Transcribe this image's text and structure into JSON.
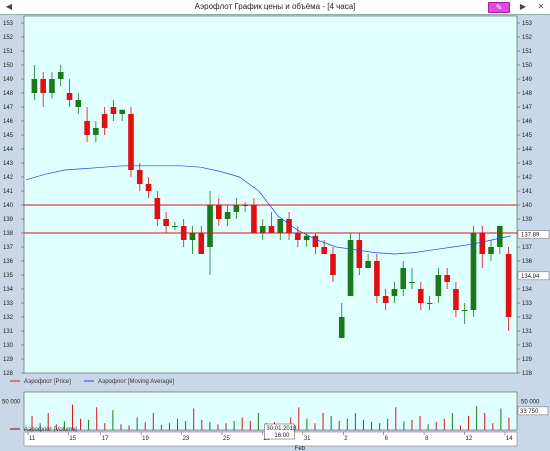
{
  "window": {
    "title": "Аэрофлот График цены и объёма - [4 часа]",
    "back_icon": "chevron-left-icon",
    "forward_icon": "chevron-right-icon",
    "close_icon": "close-icon",
    "draw_tool_icon": "pencil-icon"
  },
  "colors": {
    "plot_bg": "#e0ffff",
    "up": "#1a7a1a",
    "down": "#e01010",
    "ma": "#2040ff",
    "hline": "#e01010"
  },
  "price_chart": {
    "type": "candlestick",
    "y_ticks": [
      128,
      129,
      130,
      131,
      132,
      133,
      134,
      135,
      136,
      137,
      138,
      139,
      140,
      141,
      142,
      143,
      144,
      145,
      146,
      147,
      148,
      149,
      150,
      151,
      152,
      153
    ],
    "ylim": [
      128,
      153.5
    ],
    "price_badges": [
      "137.89",
      "134.94"
    ],
    "badge_values": [
      137.89,
      134.94
    ],
    "horizontal_lines": [
      140,
      138
    ],
    "legend": [
      "Аэрофлот [Price]",
      "Аэрофлот [Moving Average]"
    ]
  },
  "volume_chart": {
    "y_label_left": "50 000",
    "y_label_right": "50 000",
    "badge": "33 750",
    "badge_value": 33750,
    "legend": "Аэрофлот [Volume]"
  },
  "x_axis": {
    "labels": [
      "11",
      "15",
      "17",
      "19",
      "23",
      "25",
      "29",
      "31",
      "2",
      "6",
      "8",
      "12",
      "14"
    ],
    "label_index": [
      0,
      5,
      9,
      14,
      19,
      24,
      29,
      34,
      39,
      44,
      49,
      54,
      59
    ],
    "tooltip_date": "30.01.2018",
    "tooltip_time": "16:00",
    "month_label": "Feb"
  },
  "chart_data": {
    "type": "bar",
    "candles": [
      [
        148,
        150,
        147.5,
        149
      ],
      [
        149,
        149.5,
        147,
        148
      ],
      [
        148,
        149.5,
        147.6,
        149
      ],
      [
        149,
        150,
        148.5,
        149.5
      ],
      [
        148,
        149,
        147,
        147.5
      ],
      [
        147,
        148,
        146.5,
        147.5
      ],
      [
        146,
        147,
        144.5,
        145
      ],
      [
        145,
        146,
        144.5,
        145.5
      ],
      [
        146.5,
        147,
        145,
        145.5
      ],
      [
        147,
        147.5,
        146,
        146.5
      ],
      [
        146.5,
        146.8,
        146,
        146.8
      ],
      [
        146.5,
        147,
        142,
        142.5
      ],
      [
        142.5,
        143,
        141,
        141.5
      ],
      [
        141.5,
        142,
        140.5,
        141
      ],
      [
        140.5,
        141,
        138.5,
        139
      ],
      [
        139,
        139.5,
        138,
        138.5
      ],
      [
        138.5,
        138.8,
        138.2,
        138.5
      ],
      [
        138.5,
        139,
        137,
        137.5
      ],
      [
        137.5,
        138.5,
        136.5,
        138
      ],
      [
        138,
        138.5,
        136.5,
        136.5
      ],
      [
        137,
        141,
        135,
        140
      ],
      [
        140,
        140.5,
        138.5,
        139
      ],
      [
        139,
        140,
        138.5,
        139.5
      ],
      [
        139.5,
        140.5,
        139,
        140
      ],
      [
        140,
        140.2,
        139.5,
        140
      ],
      [
        140,
        140.5,
        138,
        138
      ],
      [
        138,
        139,
        137.5,
        138.5
      ],
      [
        138.5,
        139.5,
        138,
        138
      ],
      [
        138,
        139,
        137.5,
        139
      ],
      [
        139,
        139.5,
        137.5,
        138
      ],
      [
        138,
        138.5,
        137,
        137.5
      ],
      [
        137.5,
        138,
        137,
        137.8
      ],
      [
        137.8,
        138,
        136.5,
        137
      ],
      [
        137,
        137.5,
        136.5,
        136.5
      ],
      [
        136.5,
        137,
        134.5,
        135
      ],
      [
        130.5,
        133,
        130.5,
        132
      ],
      [
        133.5,
        138,
        133.5,
        137.5
      ],
      [
        137.5,
        138,
        135,
        135.5
      ],
      [
        135.5,
        136.5,
        135.5,
        136
      ],
      [
        136,
        136.5,
        133,
        133.5
      ],
      [
        133.5,
        134,
        132.5,
        133
      ],
      [
        133.5,
        134.5,
        133,
        134
      ],
      [
        134,
        136,
        133.5,
        135.5
      ],
      [
        134.5,
        135.5,
        134,
        134.5
      ],
      [
        134,
        134.5,
        132.5,
        133
      ],
      [
        133,
        133.5,
        132.5,
        133
      ],
      [
        133.5,
        135.5,
        133,
        135
      ],
      [
        135,
        135.5,
        134,
        134.5
      ],
      [
        134,
        134.5,
        132,
        132.5
      ],
      [
        132.5,
        133,
        131.5,
        132.5
      ],
      [
        132.5,
        138.5,
        132,
        138
      ],
      [
        138,
        138.5,
        135.5,
        136.5
      ],
      [
        136.5,
        137.5,
        136,
        137
      ],
      [
        137,
        138.5,
        136.5,
        138.5
      ],
      [
        136.5,
        137,
        131,
        132
      ]
    ],
    "moving_average": [
      141.8,
      142.2,
      142.5,
      142.6,
      142.7,
      142.8,
      142.8,
      142.8,
      142.8,
      142.7,
      142.4,
      142,
      141,
      139.2,
      138.2,
      137.5,
      137,
      136.8,
      136.6,
      136.5,
      136.6,
      136.8,
      137,
      137.2,
      137.5,
      137.8
    ],
    "volume": [
      25000,
      12000,
      30000,
      10000,
      15000,
      45000,
      20000,
      18000,
      40000,
      12000,
      35000,
      10000,
      8000,
      22000,
      14000,
      30000,
      9000,
      12000,
      20000,
      16000,
      38000,
      18000,
      14000,
      10000,
      12000,
      16000,
      22000,
      16000,
      30000,
      12000,
      14000,
      10000,
      22000,
      40000,
      20000,
      12000,
      30000,
      25000,
      16000,
      20000,
      30000,
      18000,
      14000,
      12000,
      20000,
      40000,
      15000,
      18000,
      25000,
      10000,
      14000,
      20000,
      30000,
      8000,
      25000,
      42000,
      30000,
      12000,
      38000,
      22000
    ]
  }
}
